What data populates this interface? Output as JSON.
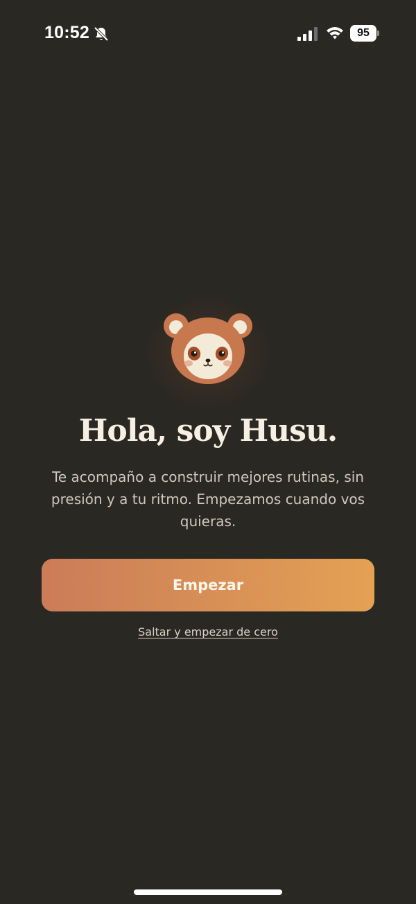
{
  "status_bar": {
    "time": "10:52",
    "battery": "95",
    "icons": [
      "bell-slash-icon",
      "signal-icon",
      "wifi-icon",
      "battery-icon"
    ]
  },
  "mascot": {
    "icon": "bear-panda-face-icon",
    "colors": {
      "fur": "#c8784e",
      "face": "#f4ead8",
      "eye_patch": "#a24e2b",
      "cheek": "#e7b29a"
    }
  },
  "onboarding": {
    "title": "Hola, soy Husu.",
    "subtitle": "Te acompaño a construir mejores rutinas, sin presión y a tu ritmo. Empezamos cuando vos quieras.",
    "primary_label": "Empezar",
    "skip_label": "Saltar y empezar de cero"
  },
  "theme": {
    "background": "#2a2823",
    "accent_start": "#cb7c58",
    "accent_end": "#e4a154",
    "text": "#f6efe2"
  }
}
